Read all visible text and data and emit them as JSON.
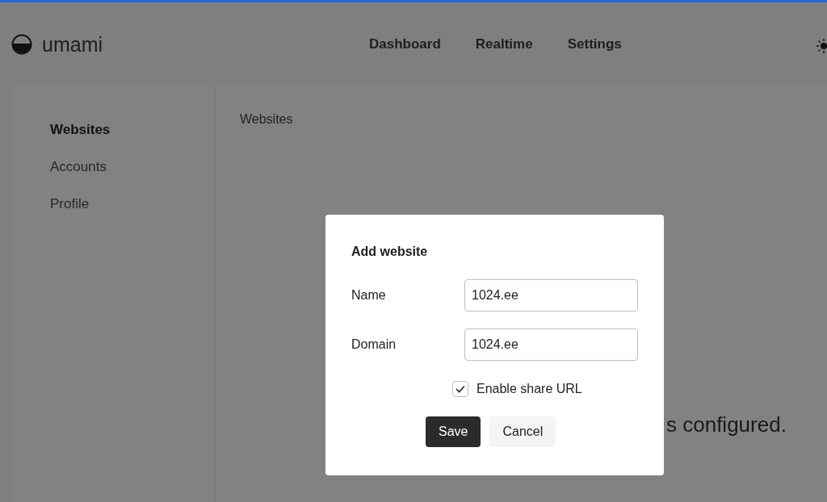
{
  "header": {
    "logo_text": "umami",
    "nav": [
      {
        "label": "Dashboard"
      },
      {
        "label": "Realtime"
      },
      {
        "label": "Settings"
      }
    ]
  },
  "sidebar": {
    "items": [
      {
        "label": "Websites",
        "selected": true
      },
      {
        "label": "Accounts",
        "selected": false
      },
      {
        "label": "Profile",
        "selected": false
      }
    ]
  },
  "main": {
    "title": "Websites",
    "empty_message": "s configured."
  },
  "dialog": {
    "title": "Add website",
    "fields": [
      {
        "label": "Name",
        "value": "1024.ee"
      },
      {
        "label": "Domain",
        "value": "1024.ee"
      }
    ],
    "checkbox": {
      "label": "Enable share URL",
      "checked": true
    },
    "buttons": [
      {
        "label": "Save",
        "kind": "primary"
      },
      {
        "label": "Cancel",
        "kind": "secondary"
      }
    ]
  }
}
